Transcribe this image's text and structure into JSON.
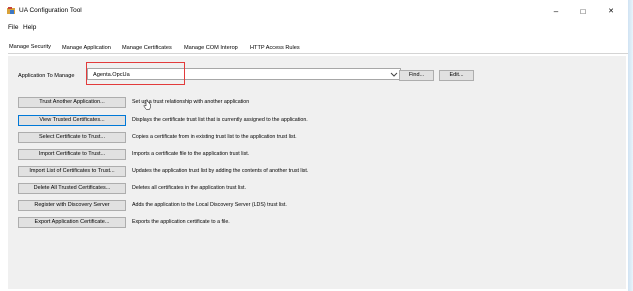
{
  "window": {
    "title": "UA Configuration Tool"
  },
  "window_controls": {
    "minimize": "–",
    "maximize": "□",
    "close": "✕"
  },
  "menu": [
    "File",
    "Help"
  ],
  "tabs": [
    "Manage Security",
    "Manage Application",
    "Manage Certificates",
    "Manage COM Interop",
    "HTTP Access Rules"
  ],
  "application": {
    "label": "Application To Manage",
    "selected": "Agenta.OpcUa",
    "find_label": "Find...",
    "edit_label": "Edit..."
  },
  "actions": [
    {
      "label": "Trust Another Application...",
      "description": "Set up a trust relationship with another application"
    },
    {
      "label": "View Trusted Certificates...",
      "description": "Displays the certificate trust list that is currently assigned to the application."
    },
    {
      "label": "Select Certificate to Trust...",
      "description": "Copies a certificate from in existing trust list to the application trust list."
    },
    {
      "label": "Import Certificate to Trust...",
      "description": "Imports a certificate file to the application trust list."
    },
    {
      "label": "Import List of Certificates to Trust...",
      "description": "Updates the application trust list by adding the contents of another trust list."
    },
    {
      "label": "Delete All Trusted Certificates...",
      "description": "Deletes all certificates in the application trust list."
    },
    {
      "label": "Register with Discovery Server",
      "description": "Adds the application to the Local Discovery Server (LDS) trust list."
    },
    {
      "label": "Export Application Certificate...",
      "description": "Exports the application certificate to a file."
    }
  ],
  "colors": {
    "highlight": "#e23b3b",
    "focus": "#0078d7",
    "panel": "#f0f0f0"
  }
}
